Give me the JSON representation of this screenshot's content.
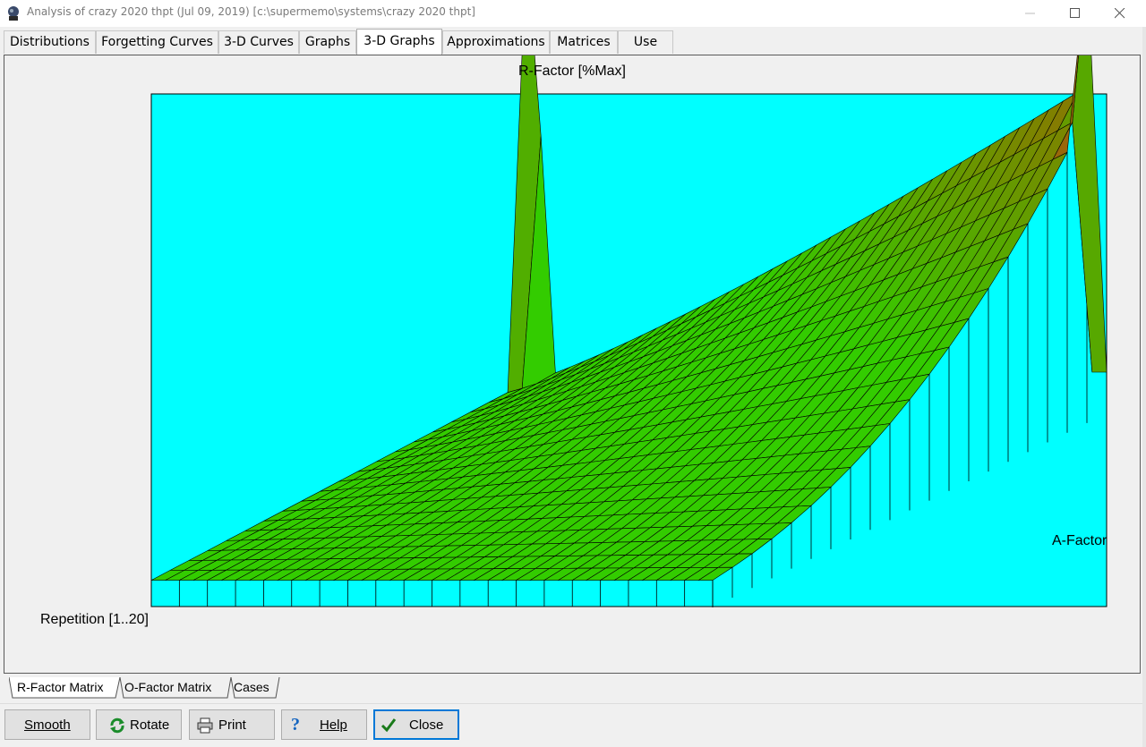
{
  "window": {
    "title": "Analysis of crazy 2020 thpt (Jul 09, 2019) [c:\\supermemo\\systems\\crazy 2020 thpt]"
  },
  "tabs": [
    {
      "label": "Distributions",
      "active": false
    },
    {
      "label": "Forgetting Curves",
      "active": false
    },
    {
      "label": "3-D Curves",
      "active": false
    },
    {
      "label": "Graphs",
      "active": false
    },
    {
      "label": "3-D Graphs",
      "active": true
    },
    {
      "label": "Approximations",
      "active": false
    },
    {
      "label": "Matrices",
      "active": false
    },
    {
      "label": "Use",
      "active": false
    }
  ],
  "graph": {
    "title": "R-Factor [%Max]",
    "x_axis_label": "A-Factor",
    "y_axis_label": "Repetition [1..20]",
    "background_color": "#00ffff",
    "low_color": "#33cc00",
    "mid_color": "#808000",
    "high_color": "#ff0033"
  },
  "subtabs": [
    {
      "label": "R-Factor Matrix",
      "active": true
    },
    {
      "label": "O-Factor Matrix",
      "active": false
    },
    {
      "label": "Cases",
      "active": false
    }
  ],
  "buttons": {
    "smooth": "Smooth",
    "rotate": "Rotate",
    "print": "Print",
    "help": "Help",
    "close": "Close"
  },
  "icons": {
    "app": "supermemo-brain-icon",
    "rotate": "refresh-icon",
    "print": "printer-icon",
    "help": "question-mark-icon",
    "close": "checkmark-icon"
  }
}
